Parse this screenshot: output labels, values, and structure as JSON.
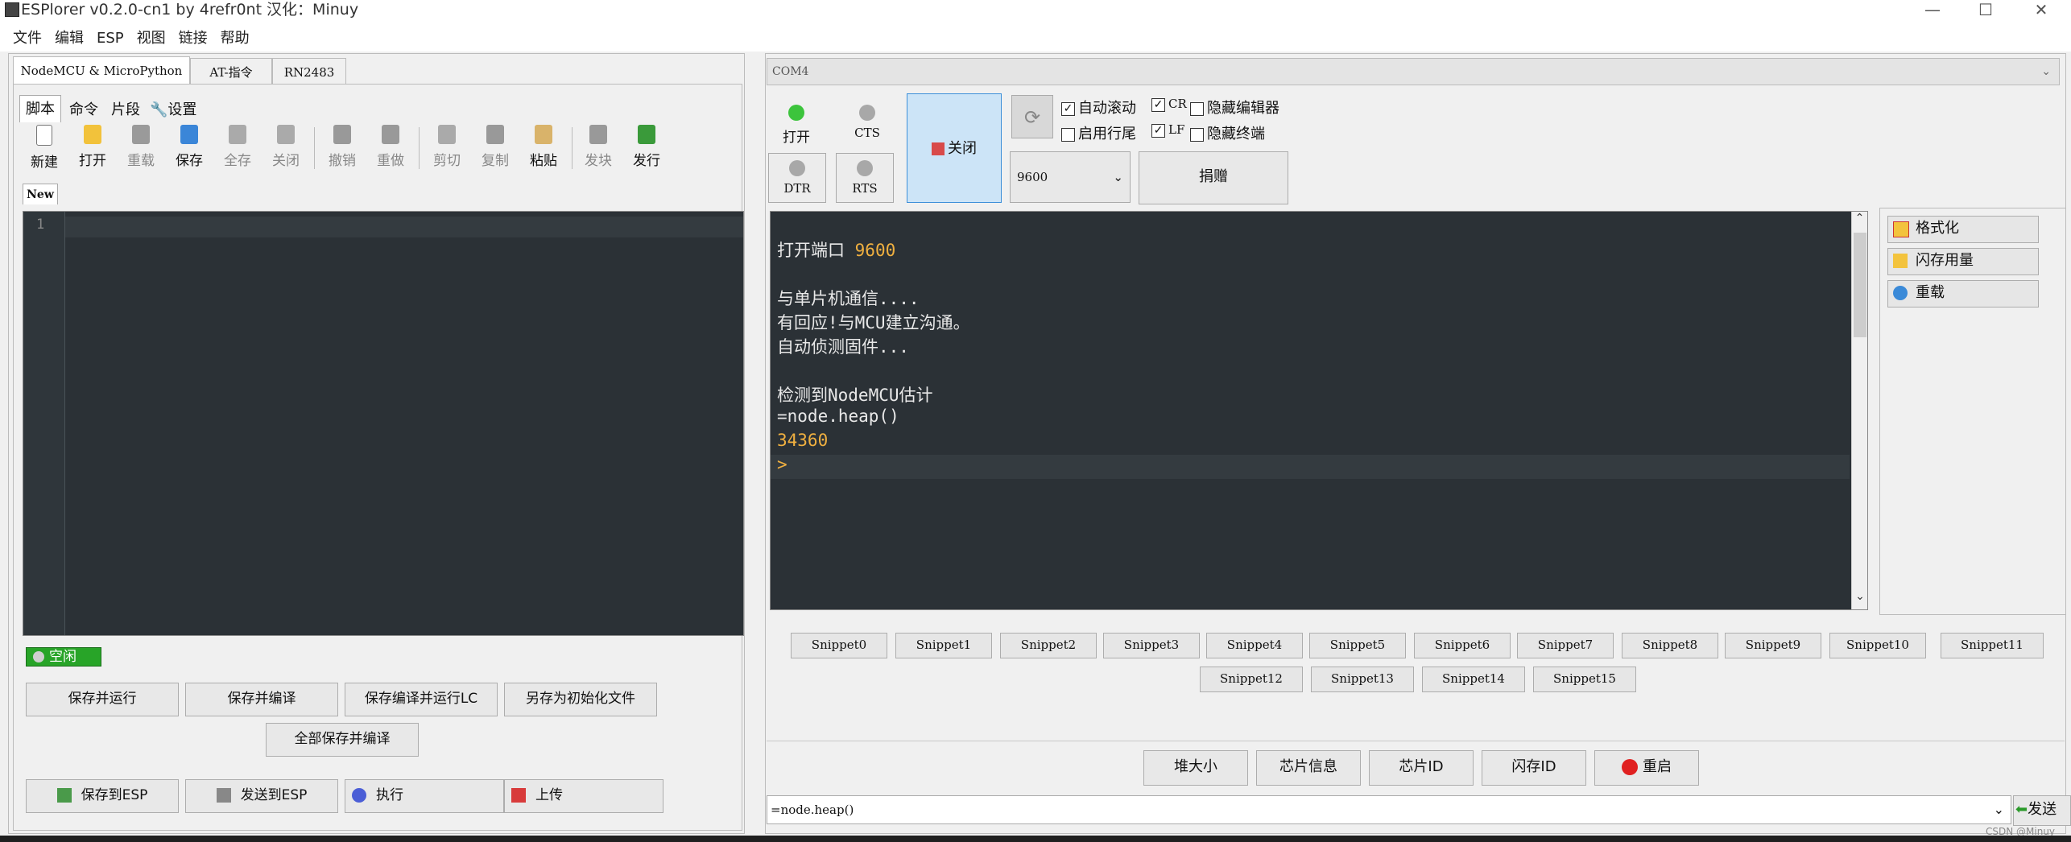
{
  "window": {
    "title": "ESPlorer v0.2.0-cn1 by 4refr0nt 汉化：Minuy",
    "min": "—",
    "max": "☐",
    "close": "✕"
  },
  "menu": [
    "文件",
    "编辑",
    "ESP",
    "视图",
    "链接",
    "帮助"
  ],
  "top_tabs": [
    "NodeMCU & MicroPython",
    "AT-指令",
    "RN2483"
  ],
  "sub_tabs": [
    "脚本",
    "命令",
    "片段",
    "设置"
  ],
  "toolbar": [
    "新建",
    "打开",
    "重载",
    "保存",
    "全存",
    "关闭",
    "撤销",
    "重做",
    "剪切",
    "复制",
    "粘贴",
    "发块",
    "发行"
  ],
  "file_tab": "New",
  "editor": {
    "line_number": "1"
  },
  "status": "空闲",
  "left_buttons": {
    "save_run": "保存并运行",
    "save_compile": "保存并编译",
    "save_compile_run_lc": "保存编译并运行LC",
    "save_as_init": "另存为初始化文件",
    "save_all_compile": "全部保存并编译",
    "save_to_esp": "保存到ESP",
    "send_to_esp": "发送到ESP",
    "execute": "执行",
    "upload": "上传"
  },
  "port": {
    "name": "COM4",
    "baud": "9600"
  },
  "serial": {
    "open_label": "打开",
    "cts_label": "CTS",
    "dtr_label": "DTR",
    "rts_label": "RTS",
    "close_label": "关闭",
    "donate_label": "捐赠",
    "auto_scroll": "自动滚动",
    "cr": "CR",
    "hide_editor": "隐藏编辑器",
    "line_end": "启用行尾",
    "lf": "LF",
    "hide_terminal": "隐藏终端"
  },
  "terminal": {
    "lines": [
      {
        "t": "打开端口 ",
        "v": "9600"
      },
      {
        "t": "",
        "v": ""
      },
      {
        "t": "与单片机通信....",
        "v": ""
      },
      {
        "t": "有回应!与MCU建立沟通。",
        "v": ""
      },
      {
        "t": "自动侦测固件...",
        "v": ""
      },
      {
        "t": "",
        "v": ""
      },
      {
        "t": "检测到NodeMCU估计",
        "v": ""
      },
      {
        "t": "=node.heap()",
        "v": ""
      },
      {
        "t": "",
        "v": "34360"
      },
      {
        "t": "",
        "v": ">"
      }
    ]
  },
  "side_buttons": [
    "格式化",
    "闪存用量",
    "重载"
  ],
  "snippets": [
    "Snippet0",
    "Snippet1",
    "Snippet2",
    "Snippet3",
    "Snippet4",
    "Snippet5",
    "Snippet6",
    "Snippet7",
    "Snippet8",
    "Snippet9",
    "Snippet10",
    "Snippet11",
    "Snippet12",
    "Snippet13",
    "Snippet14",
    "Snippet15"
  ],
  "bottom_buttons": [
    "堆大小",
    "芯片信息",
    "芯片ID",
    "闪存ID",
    "重启"
  ],
  "command": {
    "value": "=node.heap()",
    "send_label": "发送"
  },
  "watermark": "CSDN @Minuy",
  "colors": {
    "terminal_bg": "#2b3136",
    "accent_orange": "#f0b040",
    "selected_blue": "#cce4f7",
    "status_green": "#28a428"
  }
}
